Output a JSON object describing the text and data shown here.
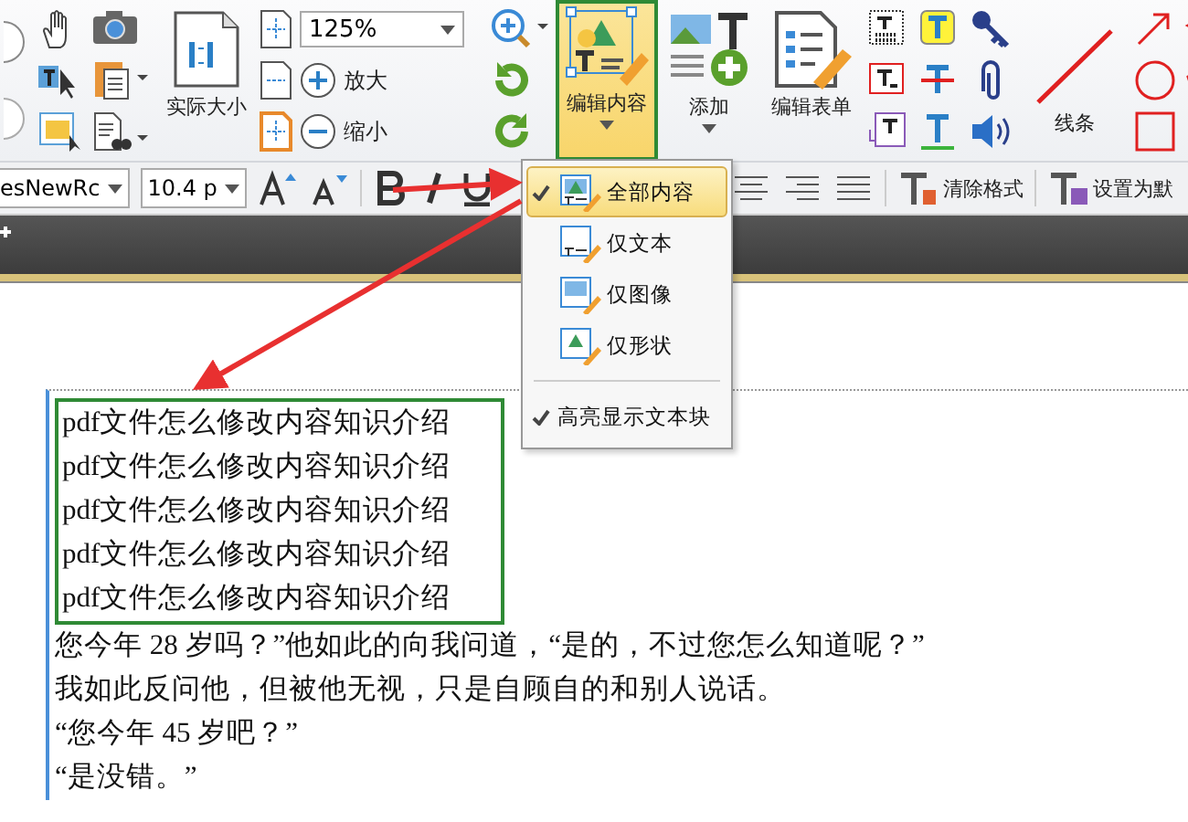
{
  "ribbon": {
    "actual_size": "实际大小",
    "zoom_value": "125%",
    "zoom_in": "放大",
    "zoom_out": "缩小",
    "edit_content": {
      "label": "编辑内容",
      "selected": true
    },
    "add": "添加",
    "edit_form": "编辑表单",
    "lines": "线条"
  },
  "format_bar": {
    "font": "esNewRc",
    "size": "10.4 p",
    "clear_format": "清除格式",
    "set_default": "设置为默"
  },
  "edit_menu": {
    "items": [
      {
        "label": "全部内容",
        "selected": true
      },
      {
        "label": "仅文本",
        "selected": false
      },
      {
        "label": "仅图像",
        "selected": false
      },
      {
        "label": "仅形状",
        "selected": false
      }
    ],
    "highlight_option": {
      "label": "高亮显示文本块",
      "checked": true
    }
  },
  "document": {
    "highlighted_lines": [
      "pdf文件怎么修改内容知识介绍",
      "pdf文件怎么修改内容知识介绍",
      "pdf文件怎么修改内容知识介绍",
      "pdf文件怎么修改内容知识介绍",
      "pdf文件怎么修改内容知识介绍"
    ],
    "lines": [
      "您今年 28 岁吗？”他如此的向我问道，“是的，不过您怎么知道呢？”",
      "我如此反问他，但被他无视，只是自顾自的和别人说话。",
      "“您今年 45 岁吧？”",
      "“是没错。”"
    ]
  }
}
